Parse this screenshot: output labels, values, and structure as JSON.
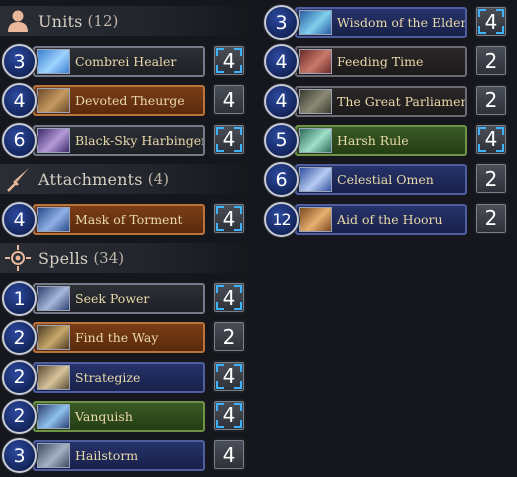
{
  "left_column": {
    "sections": [
      {
        "title": "Units",
        "count": "(12)",
        "icon": "person-silhouette-icon",
        "cards": [
          {
            "cost": "3",
            "name": "Combrei Healer",
            "qty": "4",
            "style": "neutral",
            "max": true,
            "art": "healer"
          },
          {
            "cost": "4",
            "name": "Devoted Theurge",
            "qty": "4",
            "style": "orange",
            "max": false,
            "art": "theurge"
          },
          {
            "cost": "6",
            "name": "Black-Sky Harbinger",
            "qty": "4",
            "style": "neutral",
            "max": true,
            "art": "harbinger"
          }
        ]
      },
      {
        "title": "Attachments",
        "count": "(4)",
        "icon": "sword-icon",
        "cards": [
          {
            "cost": "4",
            "name": "Mask of Torment",
            "qty": "4",
            "style": "orange",
            "max": true,
            "art": "mask"
          }
        ]
      },
      {
        "title": "Spells",
        "count": "(34)",
        "icon": "sun-emblem-icon",
        "cards": [
          {
            "cost": "1",
            "name": "Seek Power",
            "qty": "4",
            "style": "neutral",
            "max": true,
            "art": "seek"
          },
          {
            "cost": "2",
            "name": "Find the Way",
            "qty": "2",
            "style": "orange",
            "max": false,
            "art": "findway"
          },
          {
            "cost": "2",
            "name": "Strategize",
            "qty": "4",
            "style": "blue",
            "max": true,
            "art": "strategize"
          },
          {
            "cost": "2",
            "name": "Vanquish",
            "qty": "4",
            "style": "green",
            "max": true,
            "art": "vanquish"
          },
          {
            "cost": "3",
            "name": "Hailstorm",
            "qty": "4",
            "style": "blue",
            "max": false,
            "art": "hailstorm"
          }
        ]
      }
    ]
  },
  "right_column": {
    "cards": [
      {
        "cost": "3",
        "name": "Wisdom of the Elders",
        "qty": "4",
        "style": "blue",
        "max": true,
        "art": "wisdom"
      },
      {
        "cost": "4",
        "name": "Feeding Time",
        "qty": "2",
        "style": "darkred",
        "max": false,
        "art": "feeding"
      },
      {
        "cost": "4",
        "name": "The Great Parliament",
        "qty": "2",
        "style": "darkred",
        "max": false,
        "art": "parliament"
      },
      {
        "cost": "5",
        "name": "Harsh Rule",
        "qty": "4",
        "style": "green",
        "max": true,
        "art": "harsh"
      },
      {
        "cost": "6",
        "name": "Celestial Omen",
        "qty": "2",
        "style": "blue",
        "max": false,
        "art": "omen"
      },
      {
        "cost": "12",
        "name": "Aid of the Hooru",
        "qty": "2",
        "style": "blue",
        "max": false,
        "art": "hooru"
      }
    ]
  },
  "art_colors": {
    "healer": [
      "#3a7fd0",
      "#9fd3ff"
    ],
    "theurge": [
      "#6b4a2a",
      "#c59a61"
    ],
    "harbinger": [
      "#3d2a6b",
      "#b59ad8"
    ],
    "mask": [
      "#2a4a8a",
      "#8fb0e6"
    ],
    "seek": [
      "#2d3f6e",
      "#a7b8dc"
    ],
    "findway": [
      "#4a3a22",
      "#c9a86b"
    ],
    "strategize": [
      "#5a4a35",
      "#d8c39a"
    ],
    "vanquish": [
      "#2a3f6e",
      "#8fc2ef"
    ],
    "hailstorm": [
      "#3b4a5e",
      "#a6b2c4"
    ],
    "wisdom": [
      "#2a5aa0",
      "#7fd0ee"
    ],
    "feeding": [
      "#6a2a2a",
      "#c97a6a"
    ],
    "parliament": [
      "#3a3a30",
      "#8a8a74"
    ],
    "harsh": [
      "#2c6a5a",
      "#9fe0c8"
    ],
    "omen": [
      "#3050a0",
      "#b8ccf2"
    ],
    "hooru": [
      "#7a4a20",
      "#e8b070"
    ]
  }
}
